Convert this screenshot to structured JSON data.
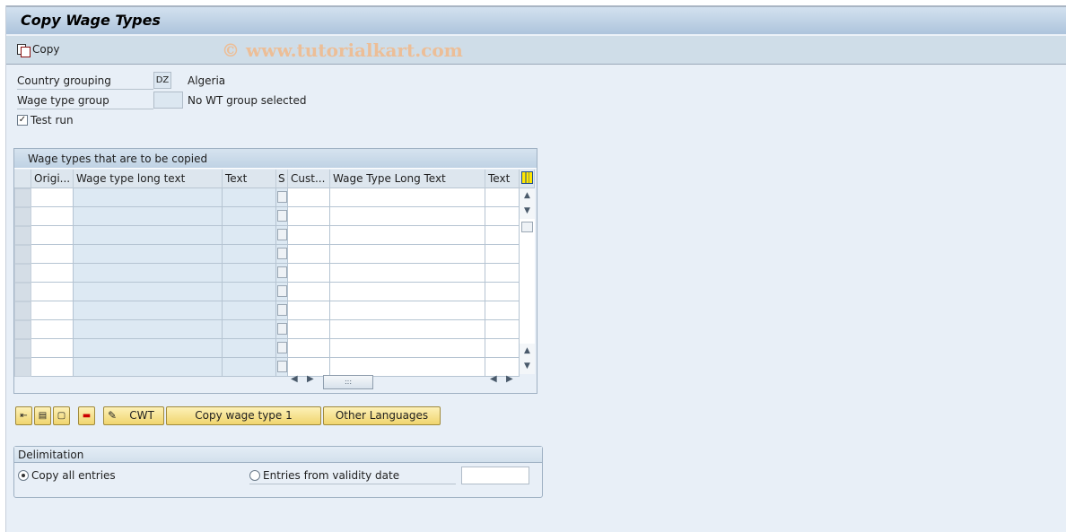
{
  "window": {
    "title": "Copy Wage Types"
  },
  "toolbar": {
    "copy_label": "Copy",
    "watermark": "© www.tutorialkart.com"
  },
  "form": {
    "country_grouping": {
      "label": "Country grouping",
      "value": "DZ",
      "description": "Algeria"
    },
    "wage_type_group": {
      "label": "Wage type group",
      "value": "",
      "description": "No WT group selected"
    },
    "test_run": {
      "label": "Test run",
      "checked": true,
      "check_glyph": "✓"
    }
  },
  "grid": {
    "title": "Wage types that are to be copied",
    "columns": [
      "Origi...",
      "Wage type long text",
      "Text",
      "S",
      "Cust...",
      "Wage Type Long Text",
      "Text"
    ],
    "row_count": 10,
    "scroll": {
      "up": "▲",
      "down": "▼",
      "left": "◀",
      "right": "▶",
      "grip": ":::"
    }
  },
  "buttons": {
    "icon_buttons": [
      "insert-row",
      "select-all",
      "deselect-all",
      "delete-row"
    ],
    "cwt": "CWT",
    "copy_wage_type": "Copy wage type 1",
    "other_languages": "Other Languages"
  },
  "delimitation": {
    "title": "Delimitation",
    "options": [
      {
        "label": "Copy all entries",
        "selected": true
      },
      {
        "label": "Entries from validity date",
        "selected": false
      }
    ],
    "date_value": ""
  }
}
